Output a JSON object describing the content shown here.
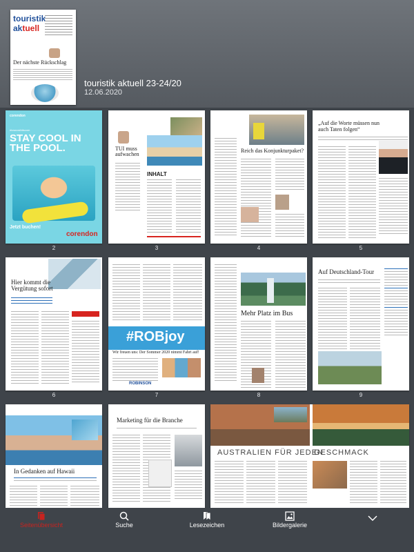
{
  "issue": {
    "title": "touristik aktuell 23-24/20",
    "date": "12.06.2020"
  },
  "cover": {
    "logo_top": "touristik",
    "logo_bottom_a": "ak",
    "logo_bottom_b": "tuell",
    "headline": "Der nächste Rückschlag"
  },
  "pages": [
    {
      "num": "2",
      "headline": "STAY COOL IN THE POOL.",
      "brand": "corendon",
      "cta": "Jetzt buchen!"
    },
    {
      "num": "3",
      "headline": "TUI muss aufwachen",
      "section": "INHALT"
    },
    {
      "num": "4",
      "headline": "Reich das Konjunkturpaket?"
    },
    {
      "num": "5",
      "headline": "„Auf die Worte müssen nun auch Taten folgen“"
    },
    {
      "num": "6",
      "headline": "Hier kommt die Vergütung sofort"
    },
    {
      "num": "7",
      "headline": "#ROBjoy",
      "subline": "Wir freuen uns: Der Sommer 2020 nimmt Fahrt auf!",
      "brand": "ROBINSON"
    },
    {
      "num": "8",
      "headline": "Mehr Platz im Bus"
    },
    {
      "num": "9",
      "headline": "Auf Deutschland-Tour"
    },
    {
      "num": "",
      "headline": "In Gedanken auf Hawaii"
    },
    {
      "num": "",
      "headline": "Marketing für die Branche"
    },
    {
      "num": "",
      "headline": "AUSTRALIEN FÜR JEDEN"
    },
    {
      "num": "",
      "headline": "GESCHMACK"
    }
  ],
  "toolbar": {
    "items": [
      {
        "label": "Seitenübersicht",
        "icon": "pages-icon",
        "active": true
      },
      {
        "label": "Suche",
        "icon": "search-icon",
        "active": false
      },
      {
        "label": "Lesezeichen",
        "icon": "bookmark-icon",
        "active": false
      },
      {
        "label": "Bildergalerie",
        "icon": "gallery-icon",
        "active": false
      }
    ],
    "more_icon": "chevron-down-icon"
  },
  "colors": {
    "background": "#3f444a",
    "header": "#62676d",
    "active": "#c8231f",
    "corendon_red": "#d7241f",
    "brand_blue": "#1f4f9a"
  }
}
